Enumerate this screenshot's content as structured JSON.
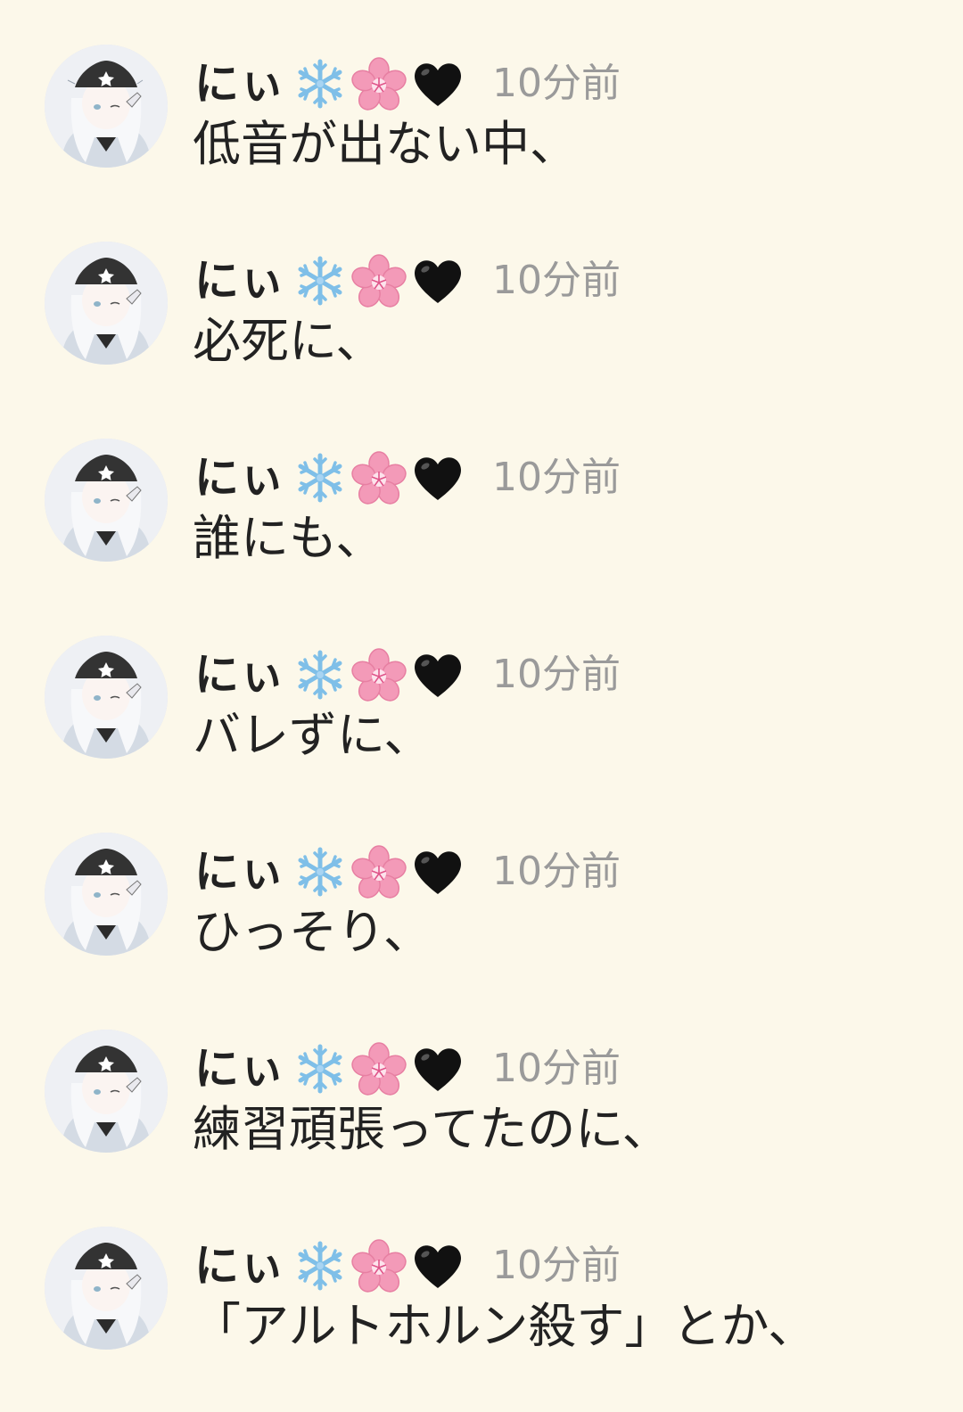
{
  "posts": [
    {
      "user": "にぃ",
      "emojis": [
        "snowflake-icon",
        "cherry-blossom-icon",
        "black-heart-icon"
      ],
      "time": "10分前",
      "message": "低音が出ない中、"
    },
    {
      "user": "にぃ",
      "emojis": [
        "snowflake-icon",
        "cherry-blossom-icon",
        "black-heart-icon"
      ],
      "time": "10分前",
      "message": "必死に、"
    },
    {
      "user": "にぃ",
      "emojis": [
        "snowflake-icon",
        "cherry-blossom-icon",
        "black-heart-icon"
      ],
      "time": "10分前",
      "message": "誰にも、"
    },
    {
      "user": "にぃ",
      "emojis": [
        "snowflake-icon",
        "cherry-blossom-icon",
        "black-heart-icon"
      ],
      "time": "10分前",
      "message": "バレずに、"
    },
    {
      "user": "にぃ",
      "emojis": [
        "snowflake-icon",
        "cherry-blossom-icon",
        "black-heart-icon"
      ],
      "time": "10分前",
      "message": "ひっそり、"
    },
    {
      "user": "にぃ",
      "emojis": [
        "snowflake-icon",
        "cherry-blossom-icon",
        "black-heart-icon"
      ],
      "time": "10分前",
      "message": "練習頑張ってたのに、"
    },
    {
      "user": "にぃ",
      "emojis": [
        "snowflake-icon",
        "cherry-blossom-icon",
        "black-heart-icon"
      ],
      "time": "10分前",
      "message": "「アルトホルン殺す」とか、"
    }
  ],
  "colors": {
    "background": "#fcf8ea",
    "username": "#222222",
    "timestamp": "#9a9a9a",
    "message": "#222222",
    "snowflake": "#7fbfe8",
    "cherry_blossom": "#f39ab8",
    "heart": "#111111"
  }
}
